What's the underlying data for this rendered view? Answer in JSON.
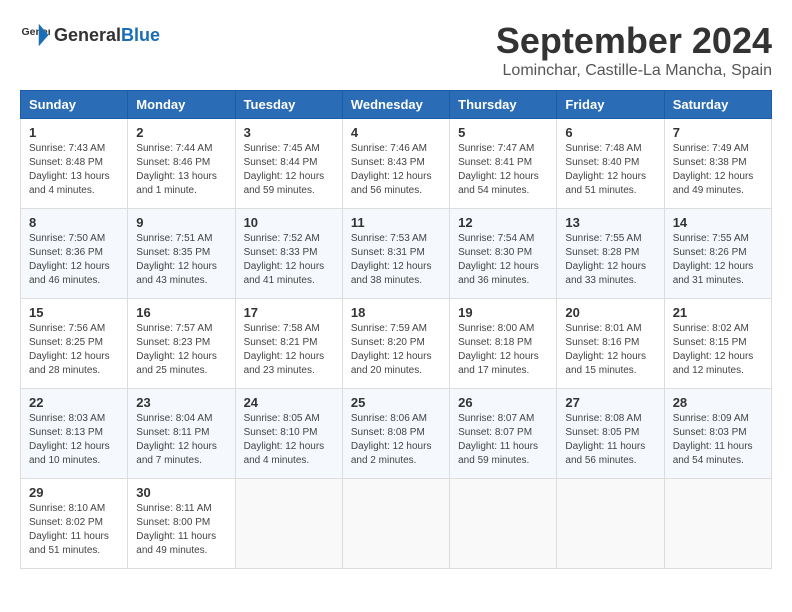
{
  "header": {
    "logo_general": "General",
    "logo_blue": "Blue",
    "month_year": "September 2024",
    "location": "Lominchar, Castille-La Mancha, Spain"
  },
  "days_of_week": [
    "Sunday",
    "Monday",
    "Tuesday",
    "Wednesday",
    "Thursday",
    "Friday",
    "Saturday"
  ],
  "weeks": [
    [
      {
        "day": "1",
        "sunrise": "7:43 AM",
        "sunset": "8:48 PM",
        "daylight": "13 hours and 4 minutes."
      },
      {
        "day": "2",
        "sunrise": "7:44 AM",
        "sunset": "8:46 PM",
        "daylight": "13 hours and 1 minute."
      },
      {
        "day": "3",
        "sunrise": "7:45 AM",
        "sunset": "8:44 PM",
        "daylight": "12 hours and 59 minutes."
      },
      {
        "day": "4",
        "sunrise": "7:46 AM",
        "sunset": "8:43 PM",
        "daylight": "12 hours and 56 minutes."
      },
      {
        "day": "5",
        "sunrise": "7:47 AM",
        "sunset": "8:41 PM",
        "daylight": "12 hours and 54 minutes."
      },
      {
        "day": "6",
        "sunrise": "7:48 AM",
        "sunset": "8:40 PM",
        "daylight": "12 hours and 51 minutes."
      },
      {
        "day": "7",
        "sunrise": "7:49 AM",
        "sunset": "8:38 PM",
        "daylight": "12 hours and 49 minutes."
      }
    ],
    [
      {
        "day": "8",
        "sunrise": "7:50 AM",
        "sunset": "8:36 PM",
        "daylight": "12 hours and 46 minutes."
      },
      {
        "day": "9",
        "sunrise": "7:51 AM",
        "sunset": "8:35 PM",
        "daylight": "12 hours and 43 minutes."
      },
      {
        "day": "10",
        "sunrise": "7:52 AM",
        "sunset": "8:33 PM",
        "daylight": "12 hours and 41 minutes."
      },
      {
        "day": "11",
        "sunrise": "7:53 AM",
        "sunset": "8:31 PM",
        "daylight": "12 hours and 38 minutes."
      },
      {
        "day": "12",
        "sunrise": "7:54 AM",
        "sunset": "8:30 PM",
        "daylight": "12 hours and 36 minutes."
      },
      {
        "day": "13",
        "sunrise": "7:55 AM",
        "sunset": "8:28 PM",
        "daylight": "12 hours and 33 minutes."
      },
      {
        "day": "14",
        "sunrise": "7:55 AM",
        "sunset": "8:26 PM",
        "daylight": "12 hours and 31 minutes."
      }
    ],
    [
      {
        "day": "15",
        "sunrise": "7:56 AM",
        "sunset": "8:25 PM",
        "daylight": "12 hours and 28 minutes."
      },
      {
        "day": "16",
        "sunrise": "7:57 AM",
        "sunset": "8:23 PM",
        "daylight": "12 hours and 25 minutes."
      },
      {
        "day": "17",
        "sunrise": "7:58 AM",
        "sunset": "8:21 PM",
        "daylight": "12 hours and 23 minutes."
      },
      {
        "day": "18",
        "sunrise": "7:59 AM",
        "sunset": "8:20 PM",
        "daylight": "12 hours and 20 minutes."
      },
      {
        "day": "19",
        "sunrise": "8:00 AM",
        "sunset": "8:18 PM",
        "daylight": "12 hours and 17 minutes."
      },
      {
        "day": "20",
        "sunrise": "8:01 AM",
        "sunset": "8:16 PM",
        "daylight": "12 hours and 15 minutes."
      },
      {
        "day": "21",
        "sunrise": "8:02 AM",
        "sunset": "8:15 PM",
        "daylight": "12 hours and 12 minutes."
      }
    ],
    [
      {
        "day": "22",
        "sunrise": "8:03 AM",
        "sunset": "8:13 PM",
        "daylight": "12 hours and 10 minutes."
      },
      {
        "day": "23",
        "sunrise": "8:04 AM",
        "sunset": "8:11 PM",
        "daylight": "12 hours and 7 minutes."
      },
      {
        "day": "24",
        "sunrise": "8:05 AM",
        "sunset": "8:10 PM",
        "daylight": "12 hours and 4 minutes."
      },
      {
        "day": "25",
        "sunrise": "8:06 AM",
        "sunset": "8:08 PM",
        "daylight": "12 hours and 2 minutes."
      },
      {
        "day": "26",
        "sunrise": "8:07 AM",
        "sunset": "8:07 PM",
        "daylight": "11 hours and 59 minutes."
      },
      {
        "day": "27",
        "sunrise": "8:08 AM",
        "sunset": "8:05 PM",
        "daylight": "11 hours and 56 minutes."
      },
      {
        "day": "28",
        "sunrise": "8:09 AM",
        "sunset": "8:03 PM",
        "daylight": "11 hours and 54 minutes."
      }
    ],
    [
      {
        "day": "29",
        "sunrise": "8:10 AM",
        "sunset": "8:02 PM",
        "daylight": "11 hours and 51 minutes."
      },
      {
        "day": "30",
        "sunrise": "8:11 AM",
        "sunset": "8:00 PM",
        "daylight": "11 hours and 49 minutes."
      },
      null,
      null,
      null,
      null,
      null
    ]
  ]
}
